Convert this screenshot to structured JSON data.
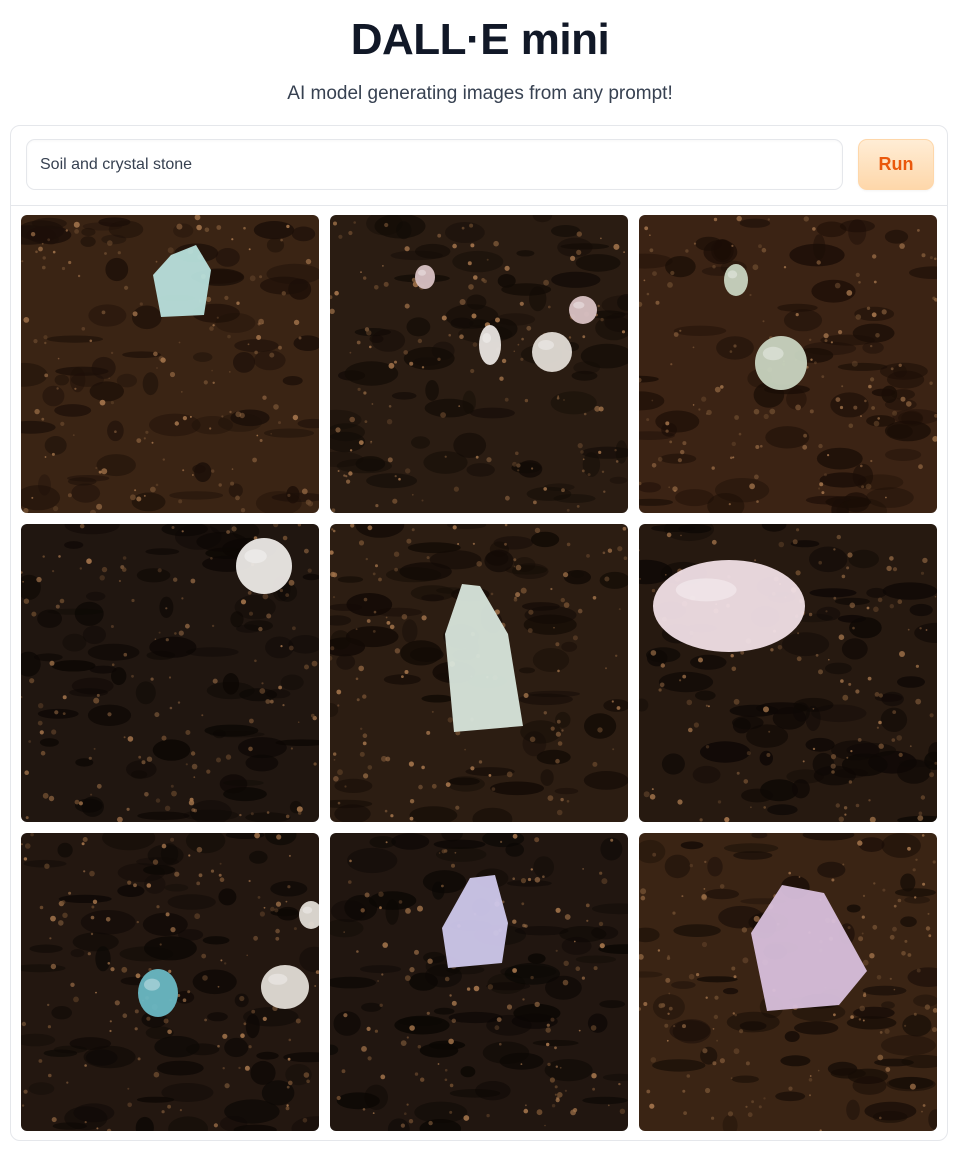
{
  "header": {
    "title": "DALL·E mini",
    "subtitle": "AI model generating images from any prompt!"
  },
  "prompt": {
    "value": "Soil and crystal stone",
    "run_label": "Run"
  },
  "colors": {
    "accent": "#ea580c",
    "button_bg": "#fed7aa",
    "border": "#e5e7eb",
    "title": "#111827"
  },
  "gallery": {
    "images": [
      {
        "soil": "#3a2414",
        "soil_dark": "#1c0f08",
        "stone": "#b8e0dc",
        "shape": "crystal",
        "subject": "pale green crystal in soil"
      },
      {
        "soil": "#2a1c12",
        "soil_dark": "#120b06",
        "stone": "#e8e4e0",
        "shape": "pebbles",
        "subject": "small pebbles on dark soil"
      },
      {
        "soil": "#3b2314",
        "soil_dark": "#1a0d06",
        "stone": "#c8d4c0",
        "shape": "two-stones",
        "subject": "two clear stones on soil"
      },
      {
        "soil": "#201610",
        "soil_dark": "#0c0704",
        "stone": "#ece9e6",
        "shape": "round",
        "subject": "white round stone on dark soil"
      },
      {
        "soil": "#2c1d12",
        "soil_dark": "#120a05",
        "stone": "#d8e6dc",
        "shape": "amethyst-point",
        "subject": "amethyst point in soil"
      },
      {
        "soil": "#261910",
        "soil_dark": "#0e0805",
        "stone": "#f0dfe6",
        "shape": "large-round",
        "subject": "large pink stone on soil"
      },
      {
        "soil": "#231710",
        "soil_dark": "#0d0805",
        "stone": "#6ab8c4",
        "shape": "blue-and-pink",
        "subject": "blue and pink stones on soil"
      },
      {
        "soil": "#211610",
        "soil_dark": "#0b0704",
        "stone": "#cfc8ec",
        "shape": "lavender",
        "subject": "lavender crystal on soil"
      },
      {
        "soil": "#3a2414",
        "soil_dark": "#160c06",
        "stone": "#d8c0dc",
        "shape": "pink-crystal",
        "subject": "pink quartz crystal in soil"
      }
    ]
  }
}
